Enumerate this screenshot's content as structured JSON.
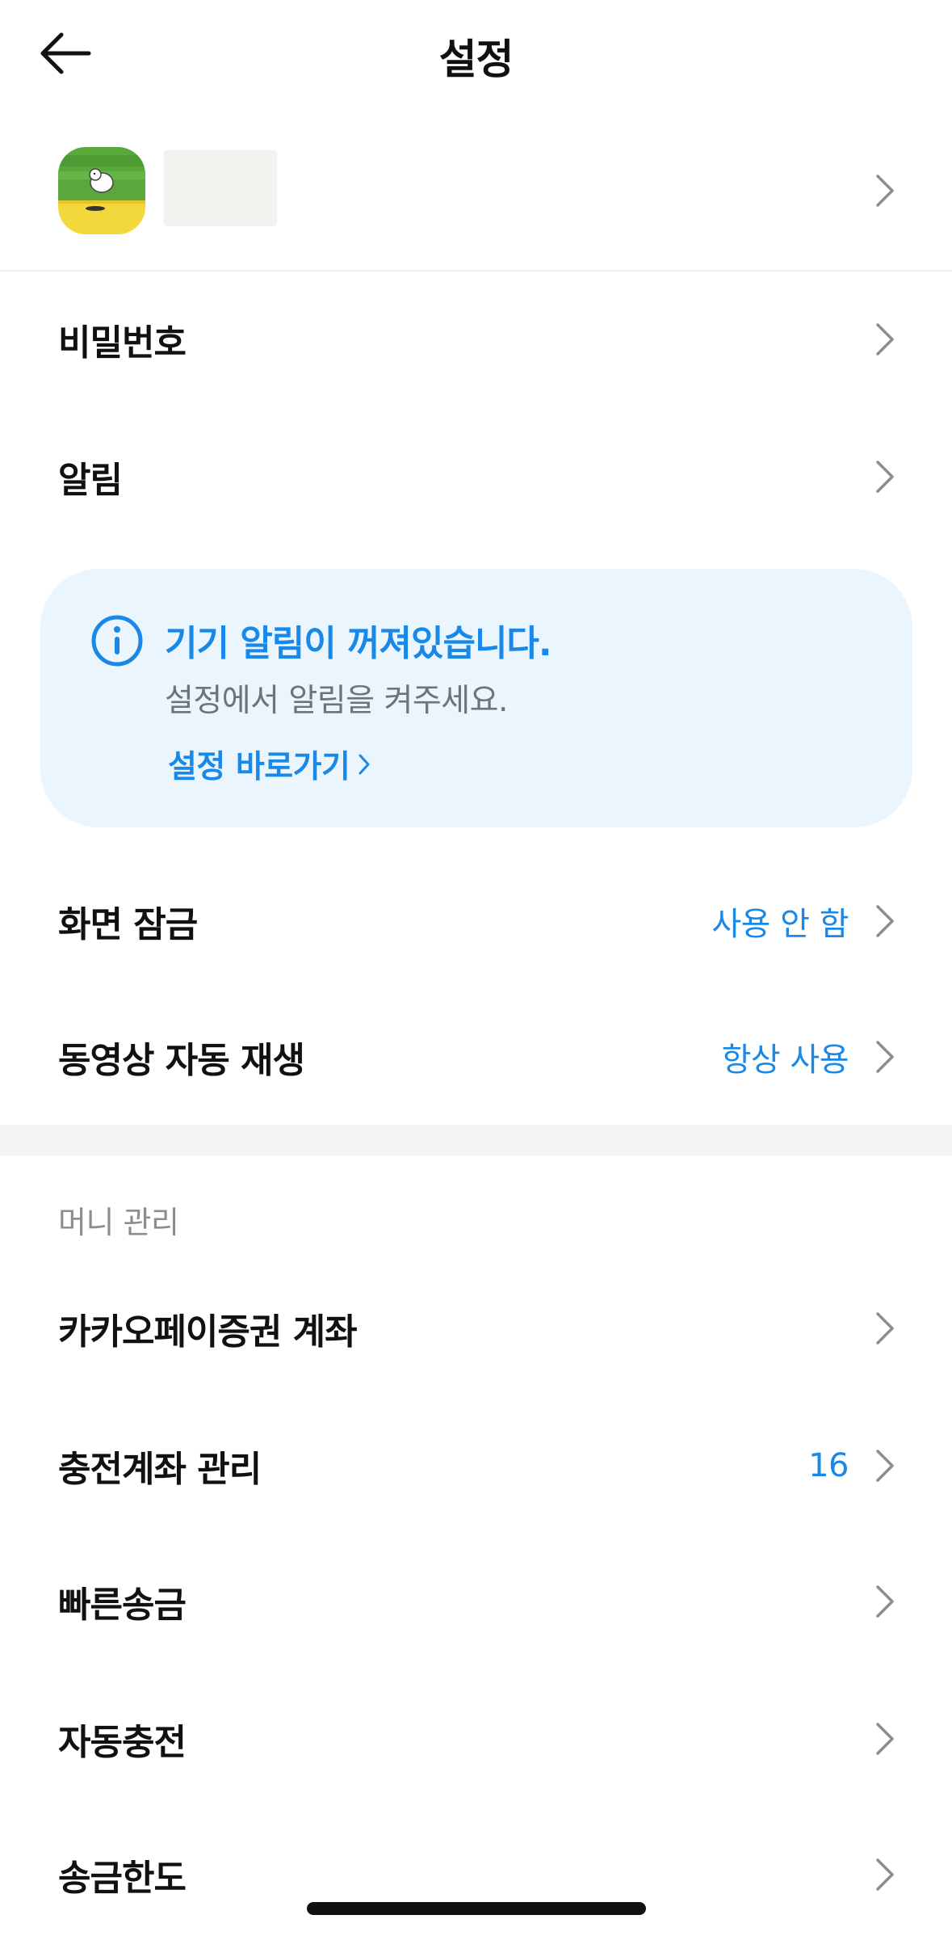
{
  "header": {
    "title": "설정"
  },
  "settings": [
    {
      "label": "비밀번호"
    },
    {
      "label": "알림"
    }
  ],
  "banner": {
    "title": "기기 알림이 꺼져있습니다.",
    "description": "설정에서 알림을 켜주세요.",
    "link_label": "설정 바로가기"
  },
  "display": [
    {
      "label": "화면 잠금",
      "value": "사용 안 함"
    },
    {
      "label": "동영상 자동 재생",
      "value": "항상 사용"
    }
  ],
  "money": {
    "section_title": "머니 관리",
    "items": [
      {
        "label": "카카오페이증권 계좌",
        "value": ""
      },
      {
        "label": "충전계좌 관리",
        "value": "16"
      },
      {
        "label": "빠른송금",
        "value": ""
      },
      {
        "label": "자동충전",
        "value": ""
      },
      {
        "label": "송금한도",
        "value": ""
      }
    ]
  },
  "colors": {
    "accent": "#1a88e6",
    "banner_bg": "#eaf5fd",
    "text": "#111111",
    "muted": "#8a8d91"
  }
}
